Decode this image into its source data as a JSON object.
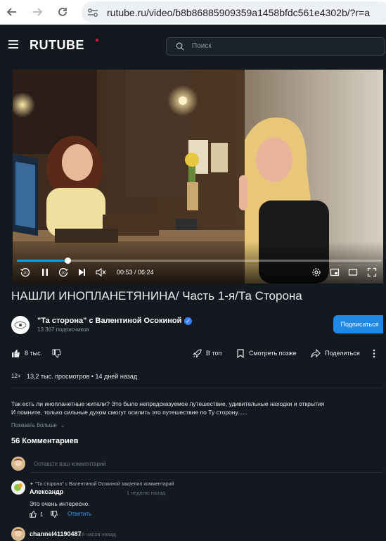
{
  "browser": {
    "url": "rutube.ru/video/b8b86885909359a1458bfdc561e4302b/?r=a"
  },
  "header": {
    "logo": "RUTUBE",
    "search_placeholder": "Поиск"
  },
  "player": {
    "current_time": "00:53",
    "duration": "06:24",
    "time_display": "00:53 / 06:24",
    "progress_fraction": 0.138,
    "rewind_label": "10",
    "forward_label": "10"
  },
  "video": {
    "title": "НАШЛИ ИНОПЛАНЕТЯНИНА/ Часть 1-я/Та Сторона"
  },
  "channel": {
    "name": "\"Та сторона\" с Валентиной Осокиной",
    "subscribers": "13 367 подписчиков",
    "subscribe_label": "Подписаться"
  },
  "actions": {
    "likes": "8 тыс.",
    "top_label": "В топ",
    "watch_later_label": "Смотреть позже",
    "share_label": "Поделиться"
  },
  "meta": {
    "age": "12+",
    "views_and_date": "13,2 тыс. просмотров • 14 дней назад"
  },
  "description": {
    "line1": "Так есть ли инопланетные жители? Это было непредсказуемое путешествие, удивительные находки и открытия",
    "line2": "И помните, только сильные духом смогут осилить это путешествие по Ту сторону......",
    "show_more": "Показать больше"
  },
  "comments": {
    "count_label": "56 Комментариев",
    "input_placeholder": "Оставьте ваш комментарий",
    "items": [
      {
        "pinned_note": "\"Та сторона\" с Валентиной Осокиной закрепил комментарий",
        "author": "Александр",
        "time": "1 неделю назад",
        "text": "Это очень интересно.",
        "likes": "1",
        "reply_label": "Ответить"
      },
      {
        "author": "channel41190487",
        "time": "19 часов назад"
      }
    ]
  },
  "colors": {
    "background": "#14191f",
    "accent_blue": "#1e88e5",
    "progress": "#00a1e7",
    "logo_dot": "#ed143b"
  }
}
